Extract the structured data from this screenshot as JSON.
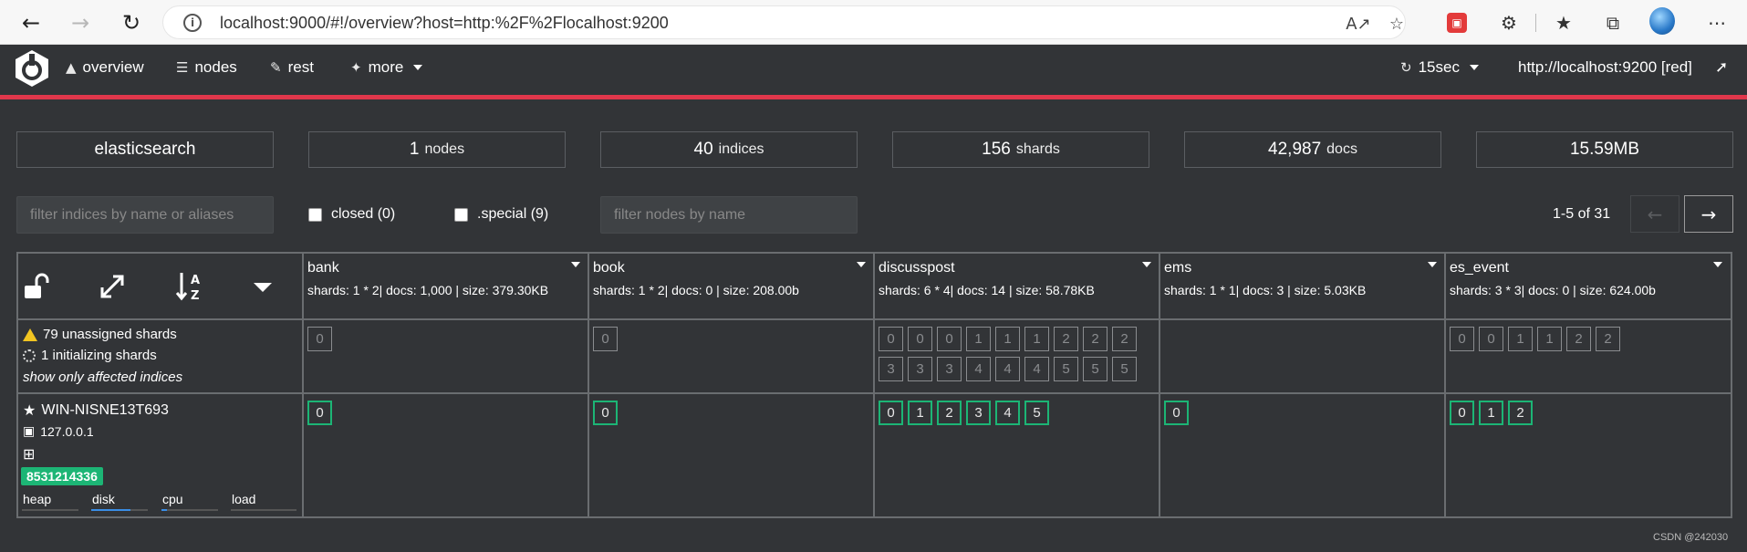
{
  "browser": {
    "url": "localhost:9000/#!/overview?host=http:%2F%2Flocalhost:9200",
    "icons": [
      "back-arrow-icon",
      "forward-arrow-icon",
      "refresh-icon",
      "info-icon",
      "read-aloud-icon",
      "favorite-add-icon",
      "extension-red-icon",
      "puzzle-extensions-icon",
      "favorites-icon",
      "collections-icon",
      "profile-avatar",
      "more-dots-icon"
    ]
  },
  "nav": {
    "overview": "overview",
    "nodes": "nodes",
    "rest": "rest",
    "more": "more",
    "refresh_interval": "15sec",
    "cluster_url": "http://localhost:9200 [red]"
  },
  "stats": {
    "cluster_name": "elasticsearch",
    "nodes_count": "1",
    "nodes_label": "nodes",
    "indices_count": "40",
    "indices_label": "indices",
    "shards_count": "156",
    "shards_label": "shards",
    "docs_count": "42,987",
    "docs_label": "docs",
    "size": "15.59MB"
  },
  "filters": {
    "indices_placeholder": "filter indices by name or aliases",
    "closed_label": "closed (0)",
    "special_label": ".special (9)",
    "nodes_placeholder": "filter nodes by name",
    "pagination": "1-5 of 31",
    "prev": "←",
    "next": "→"
  },
  "summary": {
    "unassigned": "79 unassigned shards",
    "initializing": "1 initializing shards",
    "affected": "show only affected indices"
  },
  "node": {
    "name": "WIN-NISNE13T693",
    "ip": "127.0.0.1",
    "badge": "8531214336",
    "metrics": [
      "heap",
      "disk",
      "cpu",
      "load"
    ]
  },
  "indices": [
    {
      "name": "bank",
      "meta": "shards: 1 * 2| docs: 1,000 | size: 379.30KB",
      "unassigned": [
        [
          "0"
        ]
      ],
      "assigned": [
        "0"
      ]
    },
    {
      "name": "book",
      "meta": "shards: 1 * 2| docs: 0 | size: 208.00b",
      "unassigned": [
        [
          "0"
        ]
      ],
      "assigned": [
        "0"
      ]
    },
    {
      "name": "discusspost",
      "meta": "shards: 6 * 4| docs: 14 | size: 58.78KB",
      "unassigned": [
        [
          "0",
          "0",
          "0",
          "1",
          "1",
          "1",
          "2",
          "2",
          "2"
        ],
        [
          "3",
          "3",
          "3",
          "4",
          "4",
          "4",
          "5",
          "5",
          "5"
        ]
      ],
      "assigned": [
        "0",
        "1",
        "2",
        "3",
        "4",
        "5"
      ]
    },
    {
      "name": "ems",
      "meta": "shards: 1 * 1| docs: 3 | size: 5.03KB",
      "unassigned": [],
      "assigned": [
        "0"
      ]
    },
    {
      "name": "es_event",
      "meta": "shards: 3 * 3| docs: 0 | size: 624.00b",
      "unassigned": [
        [
          "0",
          "0",
          "1",
          "1",
          "2",
          "2"
        ]
      ],
      "assigned": [
        "0",
        "1",
        "2"
      ]
    }
  ],
  "footer": {
    "watermark": "CSDN @242030"
  }
}
